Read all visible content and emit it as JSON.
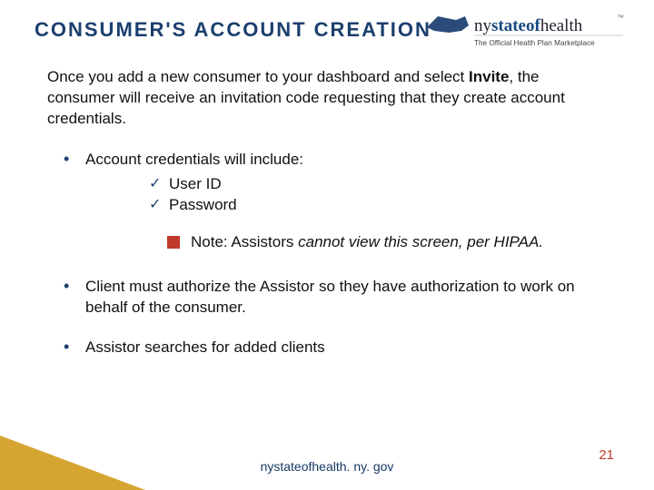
{
  "title": "CONSUMER'S ACCOUNT CREATION",
  "logo": {
    "line1_a": "ny",
    "line1_b": "stateof",
    "line1_c": "health",
    "tagline": "The Official Health Plan Marketplace"
  },
  "intro": {
    "pre": "Once you add a new consumer to your dashboard and select ",
    "bold": "Invite",
    "post": ", the consumer will receive an invitation code requesting that they create account credentials."
  },
  "bullets": {
    "credentials_label": "Account credentials will include:",
    "credentials_items": [
      "User ID",
      "Password"
    ],
    "authorize": "Client must authorize the Assistor so they have  authorization to work on behalf of the consumer.",
    "search": "Assistor searches for added clients"
  },
  "note": {
    "pre": "Note: Assistors ",
    "ital": "cannot view this screen, per HIPAA."
  },
  "footer_url": "nystateofhealth. ny. gov",
  "page_number": "21"
}
